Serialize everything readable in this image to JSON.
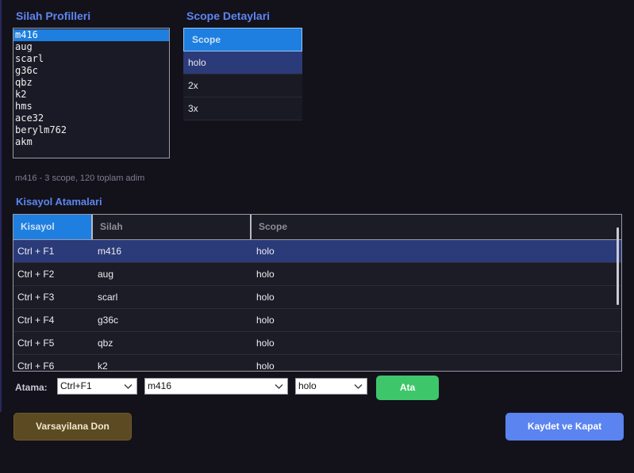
{
  "weapons": {
    "title": "Silah Profilleri",
    "items": [
      "m416",
      "aug",
      "scarl",
      "g36c",
      "qbz",
      "k2",
      "hms",
      "ace32",
      "berylm762",
      "akm"
    ],
    "selected_index": 0,
    "summary": "m416 - 3 scope, 120 toplam adim"
  },
  "scope": {
    "title": "Scope Detaylari",
    "header": "Scope",
    "rows": [
      "holo",
      "2x",
      "3x"
    ],
    "selected_index": 0
  },
  "hotkeys": {
    "title": "Kisayol Atamalari",
    "columns": [
      "Kisayol",
      "Silah",
      "Scope"
    ],
    "rows": [
      [
        "Ctrl + F1",
        "m416",
        "holo"
      ],
      [
        "Ctrl + F2",
        "aug",
        "holo"
      ],
      [
        "Ctrl + F3",
        "scarl",
        "holo"
      ],
      [
        "Ctrl + F4",
        "g36c",
        "holo"
      ],
      [
        "Ctrl + F5",
        "qbz",
        "holo"
      ],
      [
        "Ctrl + F6",
        "k2",
        "holo"
      ]
    ],
    "selected_index": 0
  },
  "assign": {
    "label": "Atama:",
    "hotkey_value": "Ctrl+F1",
    "weapon_value": "m416",
    "scope_value": "holo",
    "button": "Ata",
    "chevron_icon": "chevron-down-icon"
  },
  "footer": {
    "default_button": "Varsayilana Don",
    "save_button": "Kaydet ve Kapat"
  },
  "colors": {
    "accent": "#1e7fe0",
    "title": "#5d86f0",
    "selected_row": "#2b3a78",
    "assign_button": "#3dc76a",
    "save_button": "#5b84f0",
    "default_button": "#5c4a22",
    "background": "#13121b"
  }
}
